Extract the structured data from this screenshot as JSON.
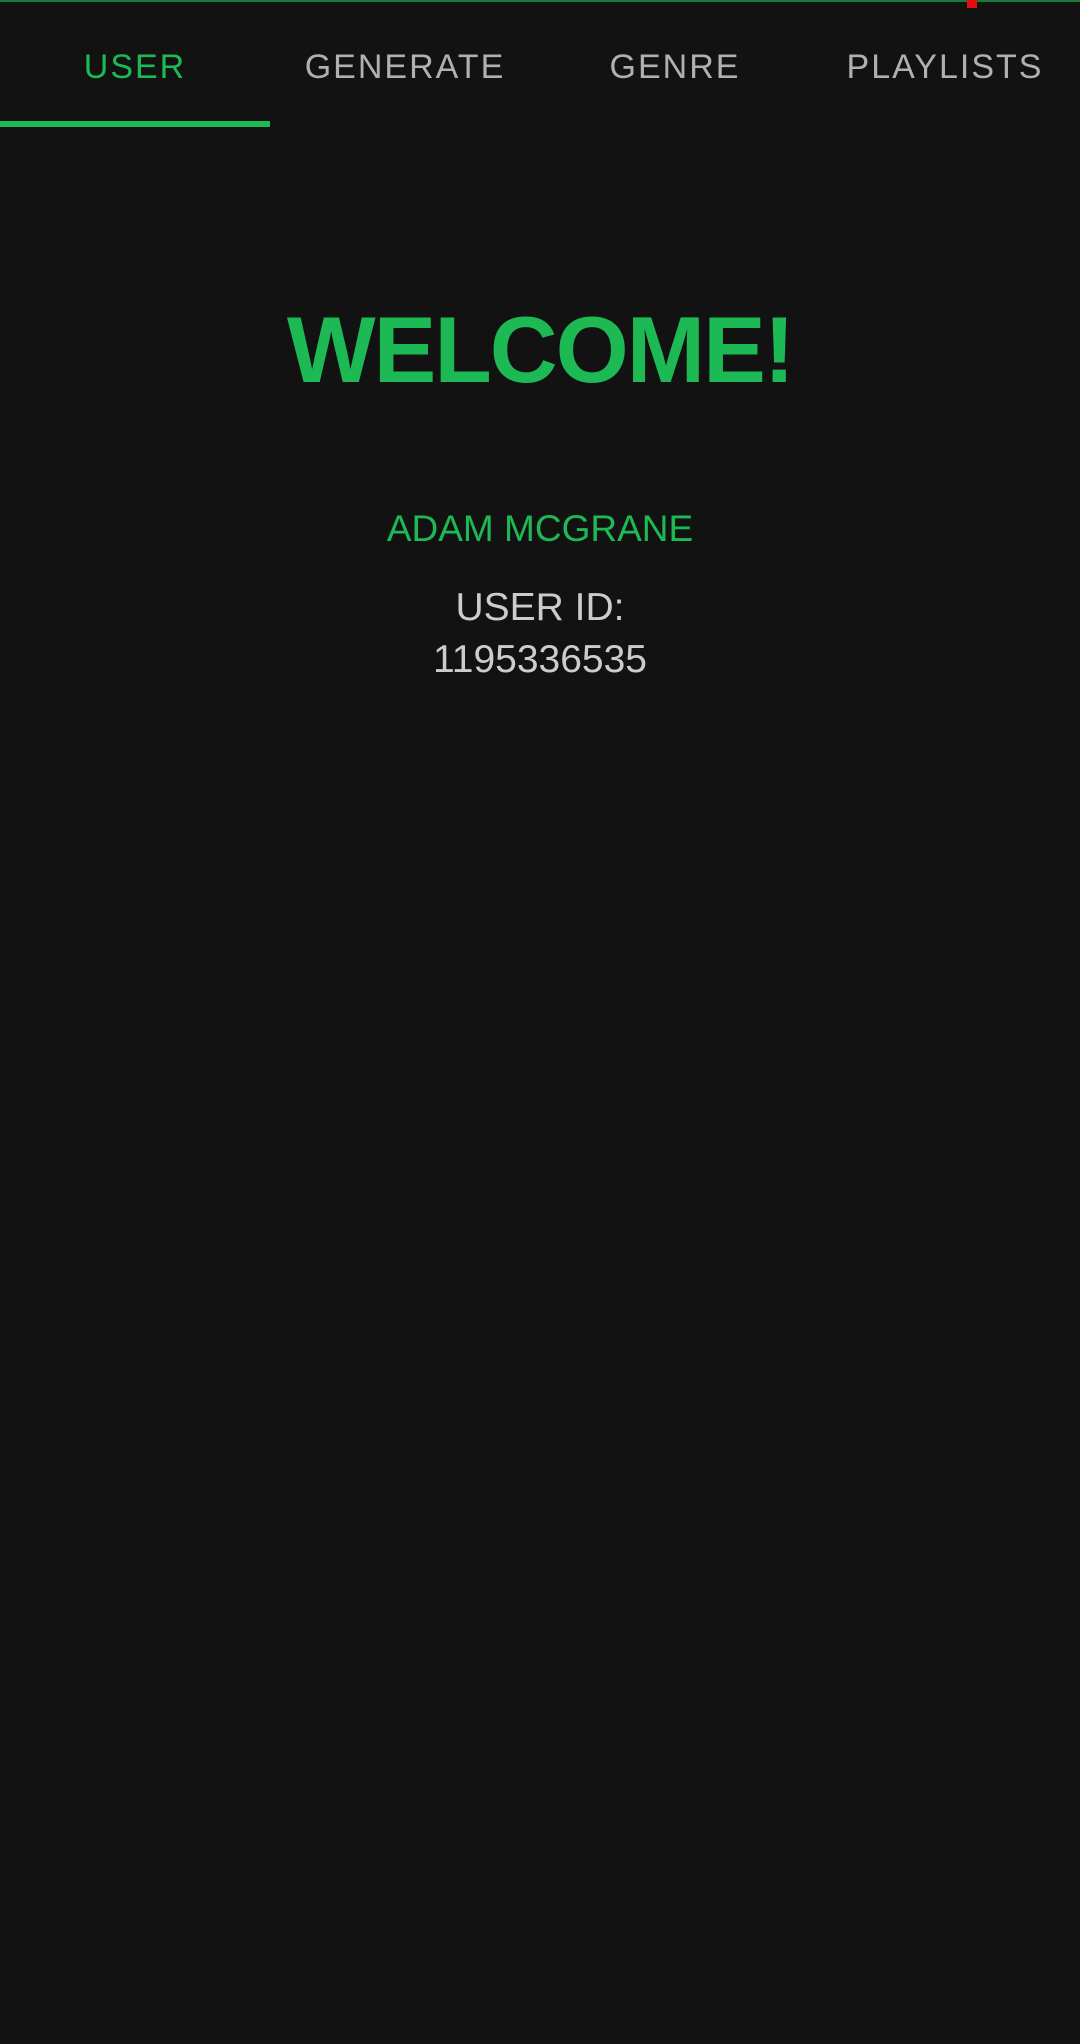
{
  "tabs": [
    {
      "label": "USER",
      "active": true
    },
    {
      "label": "GENERATE",
      "active": false
    },
    {
      "label": "GENRE",
      "active": false
    },
    {
      "label": "PLAYLISTS",
      "active": false
    }
  ],
  "main": {
    "welcome": "WELCOME!",
    "user_name": "ADAM MCGRANE",
    "user_id_label": "USER ID:",
    "user_id": "1195336535"
  },
  "colors": {
    "accent": "#1db954",
    "background": "#121212",
    "text": "#cccccc"
  }
}
